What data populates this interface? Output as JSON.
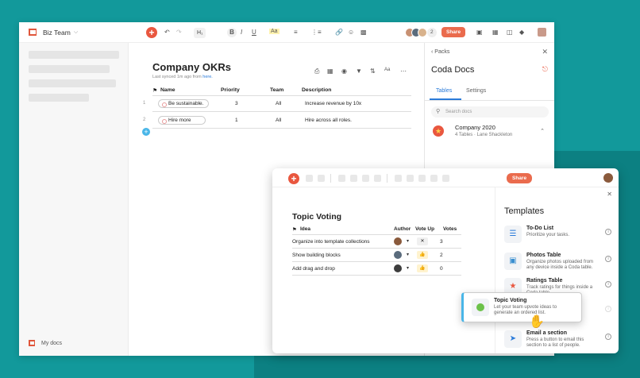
{
  "window1": {
    "doc_title": "Biz Team",
    "heading_button": "H₁",
    "bold": "B",
    "italic": "I",
    "underline": "U",
    "highlight": "Aa",
    "avatar_count": "2",
    "share_label": "Share",
    "sidebar_footer": "My docs",
    "doc_heading": "Company OKRs",
    "synced_text": "Last synced 1m ago from",
    "synced_link": "here.",
    "table": {
      "columns": [
        "Name",
        "Priority",
        "Team",
        "Description"
      ],
      "rows": [
        {
          "num": "1",
          "name": "Be sustainable.",
          "priority": "3",
          "team": "All",
          "description": "Increase revenue by 10x"
        },
        {
          "num": "2",
          "name": "Hire more",
          "priority": "1",
          "team": "All",
          "description": "Hire across all roles."
        }
      ]
    },
    "panel": {
      "back_label": "Packs",
      "title": "Coda Docs",
      "tabs": [
        "Tables",
        "Settings"
      ],
      "search_placeholder": "Search docs",
      "pack_name": "Company 2020",
      "pack_sub": "4 Tables · Lane Shackleton"
    }
  },
  "window2": {
    "share_label": "Share",
    "doc_heading": "Topic Voting",
    "table": {
      "columns": [
        "Idea",
        "Author",
        "Vote Up",
        "Votes"
      ],
      "rows": [
        {
          "idea": "Organize into template collections",
          "vote": "✕",
          "votes": "3"
        },
        {
          "idea": "Show building blocks",
          "vote": "👍",
          "votes": "2"
        },
        {
          "idea": "Add drag and drop",
          "vote": "👍",
          "votes": "0"
        }
      ]
    },
    "panel": {
      "title": "Templates",
      "items": [
        {
          "name": "To-Do List",
          "desc": "Prioritize your tasks."
        },
        {
          "name": "Photos Table",
          "desc": "Organize photos uploaded from any device inside a Coda table."
        },
        {
          "name": "Ratings Table",
          "desc": "Track ratings for things inside a Coda table."
        },
        {
          "name": "Email a section",
          "desc": "Press a button to email this section to a list of people."
        }
      ]
    },
    "drag_card": {
      "name": "Topic Voting",
      "desc": "Let your team upvote ideas to generate an ordered list."
    }
  }
}
